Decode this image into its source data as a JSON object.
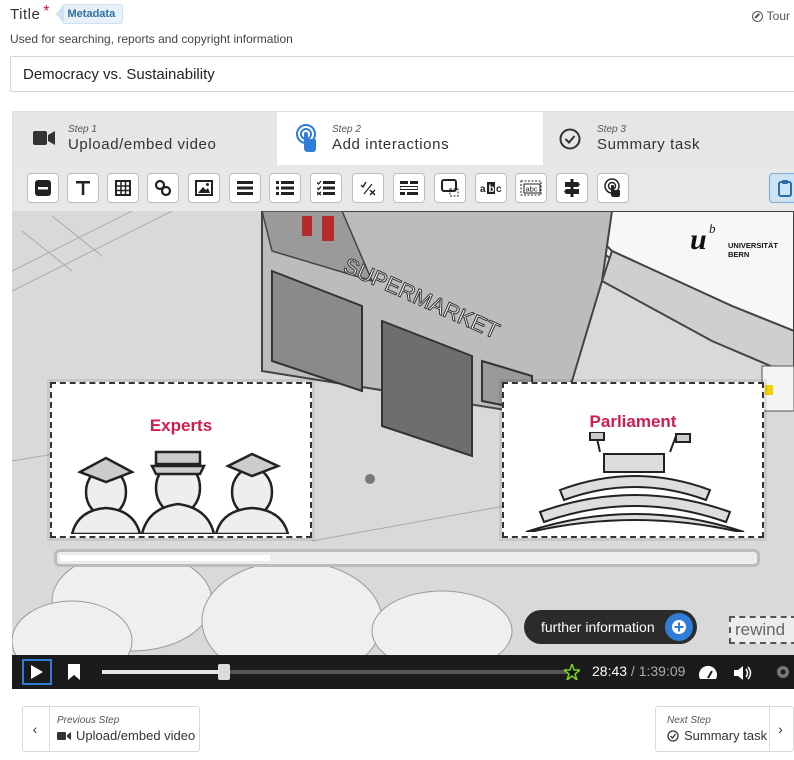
{
  "header": {
    "title_label": "Title",
    "required_mark": "*",
    "metadata_label": "Metadata",
    "tour_label": "Tour",
    "description": "Used for searching, reports and copyright information",
    "title_value": "Democracy vs. Sustainability"
  },
  "steps": [
    {
      "number": "Step 1",
      "name": "Upload/embed video",
      "icon": "video-camera-icon"
    },
    {
      "number": "Step 2",
      "name": "Add interactions",
      "icon": "touch-pointer-icon"
    },
    {
      "number": "Step 3",
      "name": "Summary task",
      "icon": "check-circle-icon"
    }
  ],
  "toolbar": {
    "items": [
      "label",
      "text",
      "table",
      "link",
      "image",
      "statements",
      "single-choice",
      "multiple-choice",
      "fill-in-blanks",
      "drag-question",
      "mark-words",
      "drag-text",
      "crossroads",
      "navigation-hotspot",
      "paste"
    ]
  },
  "video": {
    "logo_line1": "UNIVERSITÄT",
    "logo_line2": "BERN",
    "logo_letter": "u",
    "logo_sup": "b",
    "sign_text": "SUPERMARKET",
    "panel_left_title": "Experts",
    "panel_right_title": "Parliament",
    "progress_fraction": 0.3,
    "further_info_label": "further information",
    "rewind_label": "rewind"
  },
  "controls": {
    "current_time": "28:43",
    "separator": " / ",
    "duration": "1:39:09",
    "seek_fraction": 0.26
  },
  "nav": {
    "prev_small": "Previous Step",
    "prev_big": "Upload/embed video",
    "next_small": "Next Step",
    "next_big": "Summary task"
  },
  "colors": {
    "accent": "#2f7cd9",
    "required": "#d9152b",
    "panel_title": "#cf1d4d"
  }
}
